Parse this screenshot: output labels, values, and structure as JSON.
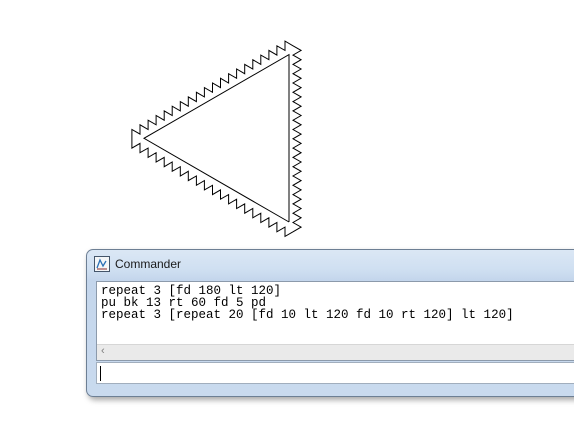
{
  "canvas": {
    "drawing": "turtle-zigzag-triangle"
  },
  "commander": {
    "title": "Commander",
    "icon": "logo-app-icon",
    "history": [
      "repeat 3 [fd 180 lt 120]",
      "pu bk 13 rt 60 fd 5 pd",
      "repeat 3 [repeat 20 [fd 10 lt 120 fd 10 rt 120] lt 120]"
    ],
    "scroll_left_glyph": "‹",
    "input_value": ""
  }
}
